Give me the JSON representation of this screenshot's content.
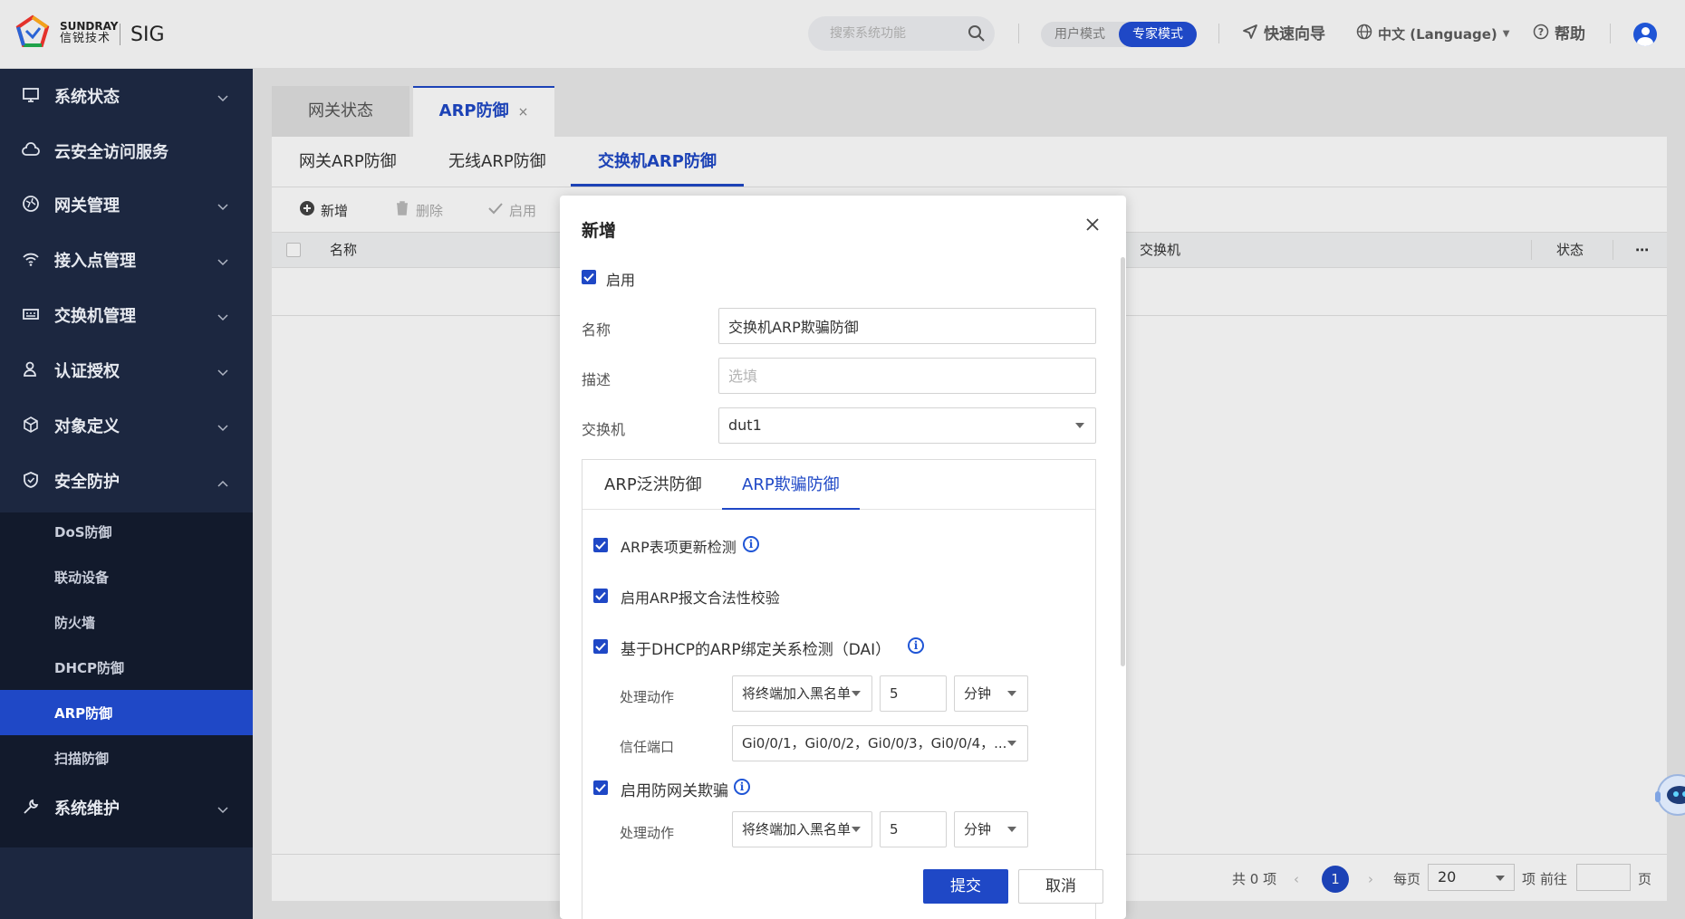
{
  "brand": {
    "company": "SUNDRAY",
    "company_cn": "信锐技术",
    "product": "SIG"
  },
  "topbar": {
    "search_placeholder": "搜索系统功能",
    "mode_user": "用户模式",
    "mode_expert": "专家模式",
    "quick_guide": "快速向导",
    "language": "中文 (Language)",
    "help": "帮助"
  },
  "sidebar": {
    "items": [
      {
        "label": "系统状态"
      },
      {
        "label": "云安全访问服务"
      },
      {
        "label": "网关管理"
      },
      {
        "label": "接入点管理"
      },
      {
        "label": "交换机管理"
      },
      {
        "label": "认证授权"
      },
      {
        "label": "对象定义"
      },
      {
        "label": "安全防护"
      },
      {
        "label": "系统维护"
      }
    ],
    "security_sub": [
      "DoS防御",
      "联动设备",
      "防火墙",
      "DHCP防御",
      "ARP防御",
      "扫描防御"
    ]
  },
  "page_tabs": [
    {
      "label": "网关状态"
    },
    {
      "label": "ARP防御",
      "close": "×"
    }
  ],
  "sub_tabs": [
    "网关ARP防御",
    "无线ARP防御",
    "交换机ARP防御"
  ],
  "toolbar": {
    "add": "新增",
    "delete": "删除",
    "enable": "启用"
  },
  "table": {
    "columns": [
      "名称",
      "交换机",
      "状态"
    ],
    "more": "⋯"
  },
  "pager": {
    "total": "共 0 项",
    "current_page": "1",
    "per_page_label": "每页",
    "per_page": "20",
    "items_unit": "项",
    "goto_label": "前往",
    "page_unit": "页"
  },
  "modal": {
    "title": "新增",
    "enable_label": "启用",
    "name_label": "名称",
    "name_value": "交换机ARP欺骗防御",
    "desc_label": "描述",
    "desc_placeholder": "选填",
    "switch_label": "交换机",
    "switch_value": "dut1",
    "tabs": [
      "ARP泛洪防御",
      "ARP欺骗防御"
    ],
    "opt1": "ARP表项更新检测",
    "opt2": "启用ARP报文合法性校验",
    "opt3": "基于DHCP的ARP绑定关系检测（DAI）",
    "action_label": "处理动作",
    "action_value": "将终端加入黑名单",
    "action_num": "5",
    "action_unit": "分钟",
    "trust_label": "信任端口",
    "trust_value": "Gi0/0/1，Gi0/0/2，Gi0/0/3，Gi0/0/4，...",
    "opt4": "启用防网关欺骗",
    "action2_label": "处理动作",
    "action2_value": "将终端加入黑名单",
    "action2_num": "5",
    "action2_unit": "分钟",
    "submit": "提交",
    "cancel": "取消"
  },
  "colors": {
    "accent": "#1f48c6",
    "sidebar": "#1c2740",
    "sidebar_sub": "#121a2c"
  }
}
